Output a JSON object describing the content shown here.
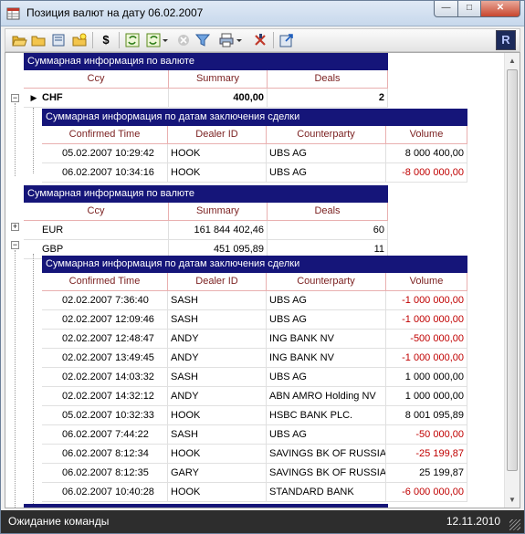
{
  "window": {
    "title": "Позиция валют на дату 06.02.2007",
    "controls": {
      "minimize": "—",
      "maximize": "□",
      "close": "✕"
    }
  },
  "toolbar": {
    "buttons": [
      "open-folder-icon",
      "folder-icon",
      "refresh-doc-icon",
      "new-icon",
      "dollar-icon",
      "refresh-icon",
      "refresh-dropdown-icon",
      "cancel-icon",
      "filter-icon",
      "print-icon",
      "delete-icon",
      "export-icon"
    ],
    "dollar_label": "$",
    "logo_label": "R"
  },
  "currency_block_1": {
    "caption": "Суммарная информация по валюте",
    "headers": [
      "Ccy",
      "Summary",
      "Deals"
    ],
    "rows": [
      {
        "ccy": "CHF",
        "summary": "400,00",
        "deals": "2"
      }
    ]
  },
  "details_block_1": {
    "caption": "Суммарная информация по датам заключения сделки",
    "headers": [
      "Confirmed Time",
      "Dealer ID",
      "Counterparty",
      "Volume"
    ],
    "rows": [
      {
        "time": "05.02.2007 10:29:42",
        "dealer": "HOOK",
        "cpty": "UBS AG",
        "volume": "8 000 400,00",
        "negative": false
      },
      {
        "time": "06.02.2007 10:34:16",
        "dealer": "HOOK",
        "cpty": "UBS AG",
        "volume": "-8 000 000,00",
        "negative": true
      }
    ]
  },
  "currency_block_2": {
    "caption": "Суммарная информация по валюте",
    "headers": [
      "Ccy",
      "Summary",
      "Deals"
    ],
    "rows": [
      {
        "ccy": "EUR",
        "summary": "161 844 402,46",
        "deals": "60"
      },
      {
        "ccy": "GBP",
        "summary": "451 095,89",
        "deals": "11"
      }
    ]
  },
  "details_block_2": {
    "caption": "Суммарная информация по датам заключения сделки",
    "headers": [
      "Confirmed Time",
      "Dealer ID",
      "Counterparty",
      "Volume"
    ],
    "rows": [
      {
        "time": "02.02.2007 7:36:40",
        "dealer": "SASH",
        "cpty": "UBS AG",
        "volume": "-1 000 000,00",
        "negative": true
      },
      {
        "time": "02.02.2007 12:09:46",
        "dealer": "SASH",
        "cpty": "UBS AG",
        "volume": "-1 000 000,00",
        "negative": true
      },
      {
        "time": "02.02.2007 12:48:47",
        "dealer": "ANDY",
        "cpty": "ING BANK NV",
        "volume": "-500 000,00",
        "negative": true
      },
      {
        "time": "02.02.2007 13:49:45",
        "dealer": "ANDY",
        "cpty": "ING BANK NV",
        "volume": "-1 000 000,00",
        "negative": true
      },
      {
        "time": "02.02.2007 14:03:32",
        "dealer": "SASH",
        "cpty": "UBS AG",
        "volume": "1 000 000,00",
        "negative": false
      },
      {
        "time": "02.02.2007 14:32:12",
        "dealer": "ANDY",
        "cpty": "ABN AMRO Holding NV",
        "volume": "1 000 000,00",
        "negative": false
      },
      {
        "time": "05.02.2007 10:32:33",
        "dealer": "HOOK",
        "cpty": "HSBC BANK PLC.",
        "volume": "8 001 095,89",
        "negative": false
      },
      {
        "time": "06.02.2007 7:44:22",
        "dealer": "SASH",
        "cpty": "UBS AG",
        "volume": "-50 000,00",
        "negative": true
      },
      {
        "time": "06.02.2007 8:12:34",
        "dealer": "HOOK",
        "cpty": "SAVINGS BK OF RUSSIA",
        "volume": "-25 199,87",
        "negative": true
      },
      {
        "time": "06.02.2007 8:12:35",
        "dealer": "GARY",
        "cpty": "SAVINGS BK OF RUSSIA",
        "volume": "25 199,87",
        "negative": false
      },
      {
        "time": "06.02.2007 10:40:28",
        "dealer": "HOOK",
        "cpty": "STANDARD BANK",
        "volume": "-6 000 000,00",
        "negative": true
      }
    ]
  },
  "statusbar": {
    "text": "Ожидание команды",
    "date": "12.11.2010"
  },
  "colors": {
    "band_caption_bg": "#151579",
    "negative_value": "#c00000",
    "header_text": "#7a1f1f",
    "statusbar_bg": "#2d2d2d"
  }
}
